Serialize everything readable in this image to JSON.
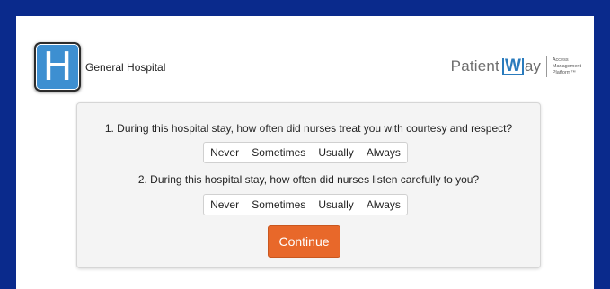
{
  "header": {
    "logo_letter": "H",
    "hospital_name": "General Hospital",
    "brand": {
      "part1": "Patient",
      "part2": "W",
      "part3": "ay",
      "tagline_line1": "Access",
      "tagline_line2": "Management",
      "tagline_line3": "Platform™"
    }
  },
  "survey": {
    "questions": [
      {
        "text": "1. During this hospital stay, how often did nurses treat you with courtesy and respect?",
        "options": [
          "Never",
          "Sometimes",
          "Usually",
          "Always"
        ]
      },
      {
        "text": "2. During this hospital stay, how often did nurses listen carefully to you?",
        "options": [
          "Never",
          "Sometimes",
          "Usually",
          "Always"
        ]
      }
    ],
    "continue_label": "Continue"
  },
  "colors": {
    "border_blue": "#0a2a8c",
    "logo_blue": "#3d8fd1",
    "continue_orange": "#e8682a",
    "brand_blue": "#2a7bbd"
  },
  "icons": {
    "logo": "hospital-h-icon"
  }
}
